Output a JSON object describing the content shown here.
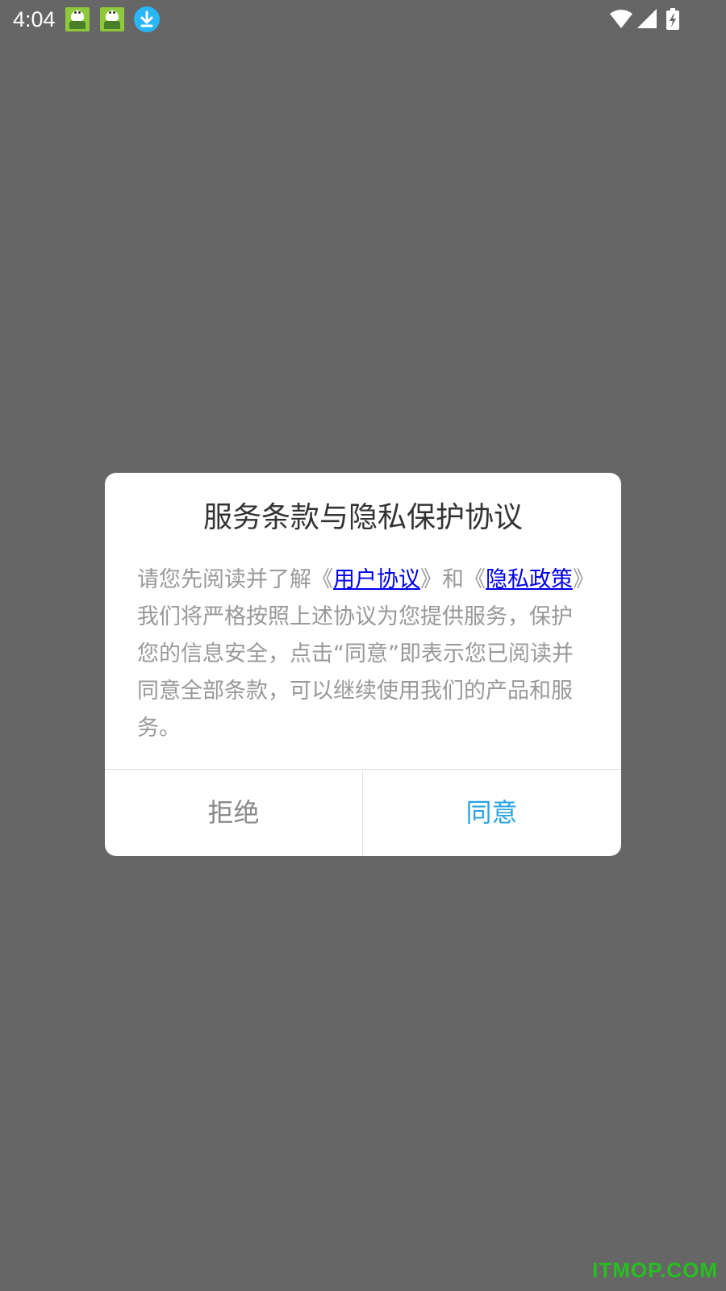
{
  "status_bar": {
    "time": "4:04",
    "left_icons": [
      "app-mascot-icon",
      "app-mascot-icon",
      "download-icon"
    ],
    "right_icons": [
      "wifi-icon",
      "cell-signal-icon",
      "battery-charging-icon"
    ]
  },
  "dialog": {
    "title": "服务条款与隐私保护协议",
    "body": {
      "text_1": "请您先阅读并了解《",
      "link_user_agreement": "用户协议",
      "text_2": "》和《",
      "link_privacy_policy": "隐私政策",
      "text_3": "》我们将严格按照上述协议为您提供服务，保护您的信息安全，点击“同意”即表示您已阅读并同意全部条款，可以继续使用我们的产品和服务。"
    },
    "buttons": {
      "reject": "拒绝",
      "agree": "同意"
    }
  },
  "watermark": "ITMOP.COM",
  "colors": {
    "overlay": "#666666",
    "dialog_bg": "#ffffff",
    "title": "#333333",
    "body_text": "#999999",
    "link": "#0000ee",
    "agree_button": "#29a3e6",
    "reject_button": "#888888",
    "watermark": "#26c01f"
  }
}
